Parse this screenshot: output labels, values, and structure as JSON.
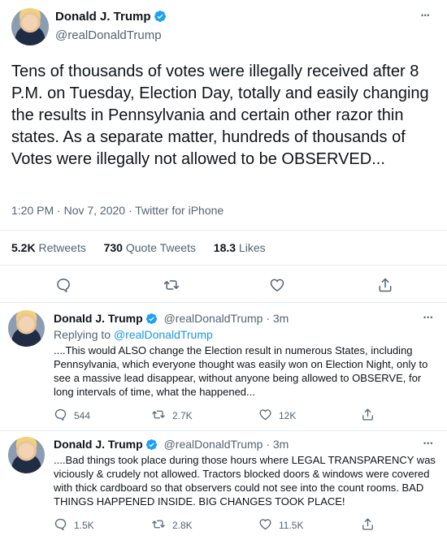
{
  "main_tweet": {
    "name": "Donald J. Trump",
    "handle": "@realDonaldTrump",
    "more": "•••",
    "text": "Tens of thousands of votes were illegally received after 8 P.M. on Tuesday, Election Day, totally and easily changing the results in Pennsylvania and certain other razor thin states. As a separate matter, hundreds of thousands of Votes were illegally not allowed to be OBSERVED...",
    "meta": "1:20 PM · Nov 7, 2020 · Twitter for iPhone",
    "stats": [
      {
        "num": "5.2K",
        "label": "Retweets"
      },
      {
        "num": "730",
        "label": "Quote Tweets"
      },
      {
        "num": "18.3",
        "label": "Likes"
      }
    ],
    "actions": [
      "reply-icon",
      "retweet-icon",
      "like-icon",
      "share-icon"
    ]
  },
  "replies": [
    {
      "name": "Donald J. Trump",
      "handle": "@realDonaldTrump",
      "time": "· 3m",
      "more": "•••",
      "replying_prefix": "Replying to ",
      "replying_handle": "@realDonaldTrump",
      "text": "....This would ALSO change the Election result in numerous States, including Pennsylvania, which everyone thought was easily won on Election Night, only to see a massive lead disappear, without anyone being allowed to OBSERVE, for long intervals of time, what the happened...",
      "reply_count": "544",
      "retweet_count": "2.7K",
      "like_count": "12K"
    },
    {
      "name": "Donald J. Trump",
      "handle": "@realDonaldTrump",
      "time": "· 3m",
      "more": "•••",
      "text": "....Bad things took place during those hours where LEGAL TRANSPARENCY was viciously & crudely not allowed. Tractors blocked doors & windows were covered with thick cardboard so that observers could not see into the count rooms. BAD THINGS HAPPENED INSIDE. BIG CHANGES TOOK PLACE!",
      "reply_count": "1.5K",
      "retweet_count": "2.8K",
      "like_count": "11.5K"
    }
  ],
  "colors": {
    "accent": "#1da1f2",
    "muted": "#536471",
    "divider": "#e6ecf0"
  }
}
